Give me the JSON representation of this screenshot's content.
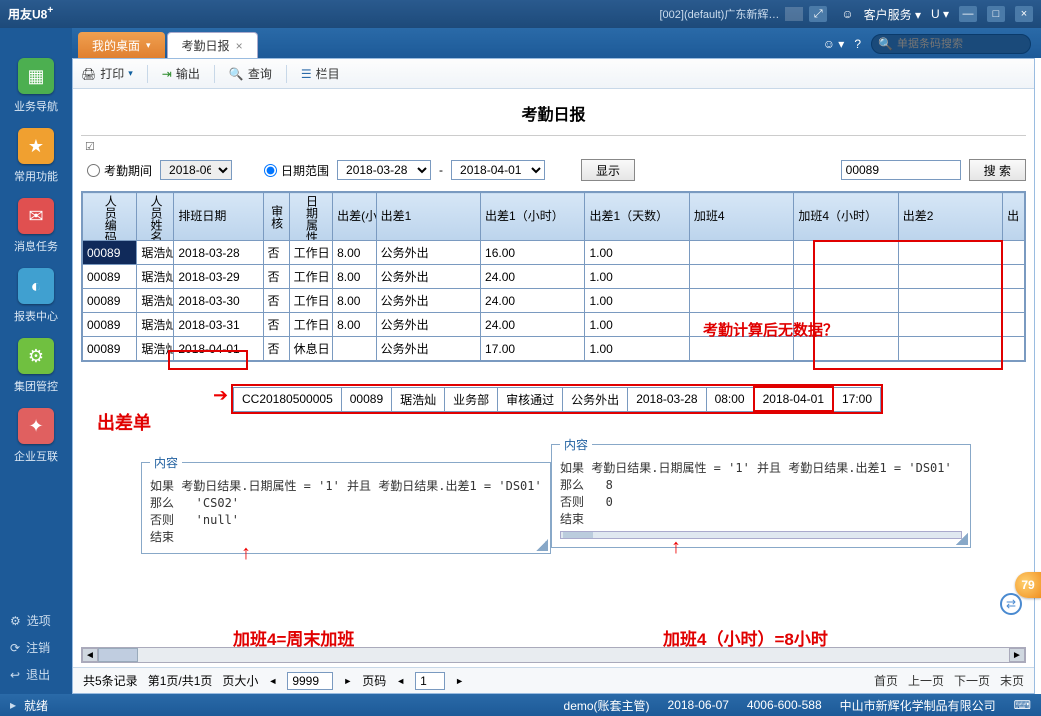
{
  "titlebar": {
    "brand": "用友U8",
    "brand_sup": "+",
    "center": "[002](default)广东新辉…",
    "service_label": "客户服务",
    "u_label": "U"
  },
  "tabs": {
    "desktop": "我的桌面",
    "report": "考勤日报"
  },
  "searchbar": {
    "placeholder": "单据条码搜索"
  },
  "sidebar": {
    "items": [
      {
        "label": "业务导航",
        "color": "#4caf50"
      },
      {
        "label": "常用功能",
        "color": "#f0a030"
      },
      {
        "label": "消息任务",
        "color": "#e05050"
      },
      {
        "label": "报表中心",
        "color": "#40a0d0"
      },
      {
        "label": "集团管控",
        "color": "#70c040"
      },
      {
        "label": "企业互联",
        "color": "#e06060"
      }
    ],
    "links": [
      {
        "label": "选项"
      },
      {
        "label": "注销"
      },
      {
        "label": "退出"
      }
    ]
  },
  "toolbar": {
    "print": "打印",
    "output": "输出",
    "query": "查询",
    "columns": "栏目"
  },
  "report": {
    "title": "考勤日报",
    "radio_period": "考勤期间",
    "period_value": "2018-06",
    "radio_range": "日期范围",
    "date_from": "2018-03-28",
    "date_to": "2018-04-01",
    "show_btn": "显示",
    "search_value": "00089",
    "search_btn": "搜 索",
    "headers": {
      "emp_code": "人员编码",
      "emp_name": "人员姓名",
      "schedule_date": "排班日期",
      "audit": "审核",
      "day_attr": "日期属性",
      "trip_hours": "出差(小时)",
      "trip1": "出差1",
      "trip1_hours": "出差1（小时）",
      "trip1_days": "出差1（天数）",
      "ot4": "加班4",
      "ot4_hours": "加班4（小时）",
      "trip2": "出差2",
      "last": "出"
    },
    "rows": [
      {
        "code": "00089",
        "name": "琚浩灿",
        "date": "2018-03-28",
        "audit": "否",
        "attr": "工作日",
        "th": "8.00",
        "t1": "公务外出",
        "t1h": "16.00",
        "t1d": "1.00"
      },
      {
        "code": "00089",
        "name": "琚浩灿",
        "date": "2018-03-29",
        "audit": "否",
        "attr": "工作日",
        "th": "8.00",
        "t1": "公务外出",
        "t1h": "24.00",
        "t1d": "1.00"
      },
      {
        "code": "00089",
        "name": "琚浩灿",
        "date": "2018-03-30",
        "audit": "否",
        "attr": "工作日",
        "th": "8.00",
        "t1": "公务外出",
        "t1h": "24.00",
        "t1d": "1.00"
      },
      {
        "code": "00089",
        "name": "琚浩灿",
        "date": "2018-03-31",
        "audit": "否",
        "attr": "工作日",
        "th": "8.00",
        "t1": "公务外出",
        "t1h": "24.00",
        "t1d": "1.00"
      },
      {
        "code": "00089",
        "name": "琚浩灿",
        "date": "2018-04-01",
        "audit": "否",
        "attr": "休息日",
        "th": "",
        "t1": "公务外出",
        "t1h": "17.00",
        "t1d": "1.00"
      }
    ]
  },
  "annotations": {
    "no_data": "考勤计算后无数据？",
    "trip_doc": "出差单",
    "ot4_weekend": "加班4=周末加班",
    "ot4_hours_8": "加班4（小时）=8小时"
  },
  "detail": {
    "cells": [
      "CC20180500005",
      "00089",
      "琚浩灿",
      "业务部",
      "审核通过",
      "公务外出",
      "2018-03-28",
      "08:00",
      "2018-04-01",
      "17:00"
    ]
  },
  "codebox_left": {
    "legend": "内容",
    "lines": [
      "如果 考勤日结果.日期属性 = '1' 并且 考勤日结果.出差1 = 'DS01'",
      "那么   'CS02'",
      "否则   'null'",
      "结束"
    ]
  },
  "codebox_right": {
    "legend": "内容",
    "lines": [
      "如果 考勤日结果.日期属性 = '1' 并且 考勤日结果.出差1 = 'DS01'",
      "那么   8",
      "否则   0",
      "结束"
    ]
  },
  "paging": {
    "total": "共5条记录",
    "page": "第1页/共1页",
    "size_label": "页大小",
    "size_value": "9999",
    "pageno_label": "页码",
    "pageno_value": "1",
    "first": "首页",
    "prev": "上一页",
    "next": "下一页",
    "last": "末页"
  },
  "status": {
    "ready": "就绪",
    "acct": "demo(账套主管)",
    "date": "2018-06-07",
    "phone": "4006-600-588",
    "company": "中山市新辉化学制品有限公司"
  },
  "badge": "79"
}
